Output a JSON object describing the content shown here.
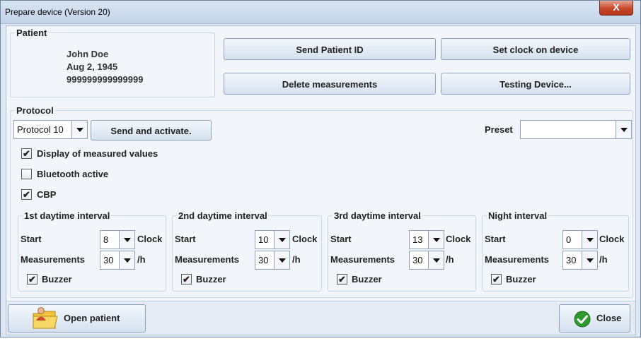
{
  "window": {
    "title": "Prepare device (Version 20)",
    "close_glyph": "X"
  },
  "patient": {
    "legend": "Patient",
    "name": "John Doe",
    "birthdate": "Aug 2, 1945",
    "id": "999999999999999"
  },
  "actions": {
    "send_patient_id": "Send Patient ID",
    "set_clock": "Set clock on device",
    "delete_measurements": "Delete measurements",
    "testing_device": "Testing Device..."
  },
  "protocol": {
    "legend": "Protocol",
    "selected": "Protocol 10",
    "send_activate": "Send and activate.",
    "preset_label": "Preset",
    "preset_value": "",
    "options": [
      {
        "label": "Display of measured values",
        "checked": true
      },
      {
        "label": "Bluetooth active",
        "checked": false
      },
      {
        "label": "CBP",
        "checked": true
      }
    ]
  },
  "field_labels": {
    "start": "Start",
    "clock_unit": "Clock",
    "measurements": "Measurements",
    "per_hour": "/h",
    "buzzer": "Buzzer"
  },
  "intervals": [
    {
      "title": "1st daytime interval",
      "start": "8",
      "measurements": "30",
      "buzzer": true
    },
    {
      "title": "2nd daytime interval",
      "start": "10",
      "measurements": "30",
      "buzzer": true
    },
    {
      "title": "3rd daytime interval",
      "start": "13",
      "measurements": "30",
      "buzzer": true
    },
    {
      "title": "Night interval",
      "start": "0",
      "measurements": "30",
      "buzzer": true
    }
  ],
  "footer": {
    "open_patient": "Open patient",
    "close": "Close"
  },
  "colors": {
    "accent_green": "#2f9a2f",
    "folder_yellow": "#f2c33a"
  },
  "icons": {
    "open_patient": "folder-person-icon",
    "close": "green-check-icon"
  }
}
